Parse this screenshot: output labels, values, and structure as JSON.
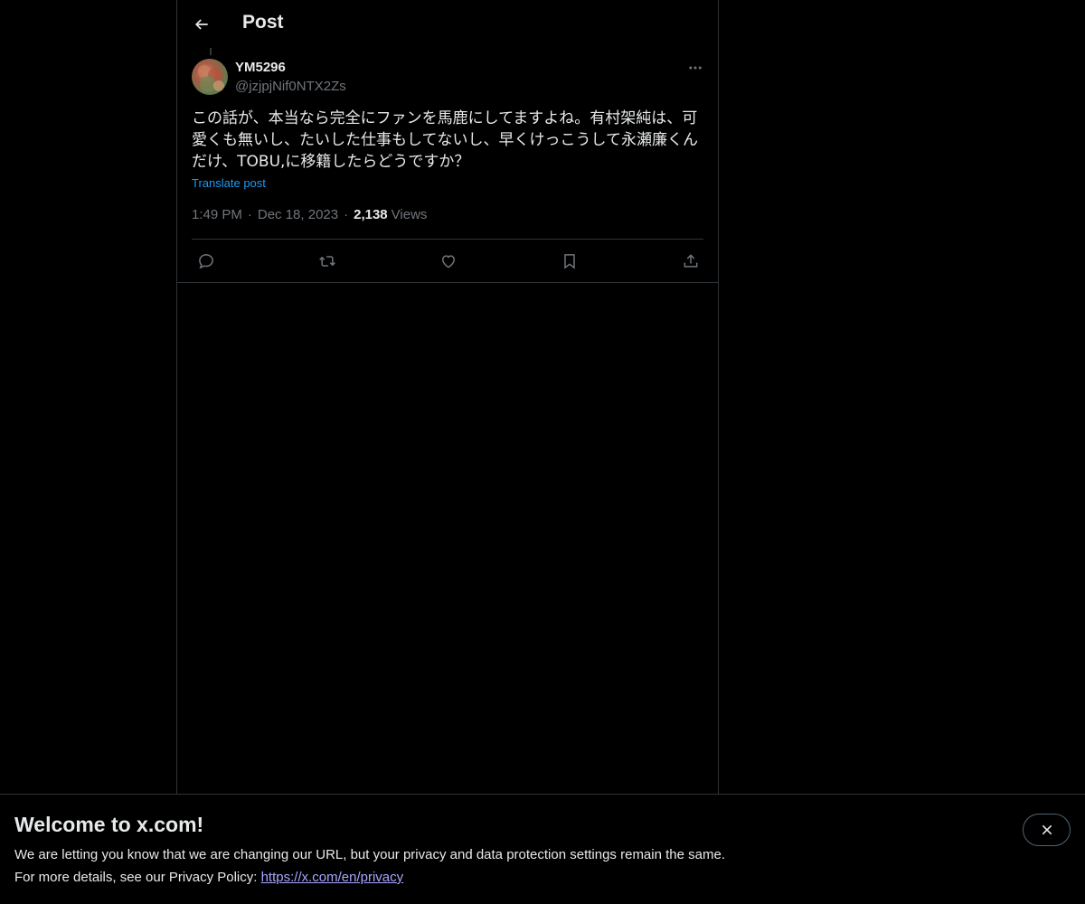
{
  "header": {
    "title": "Post"
  },
  "post": {
    "display_name": "YM5296",
    "handle": "@jzjpjNif0NTX2Zs",
    "text": "この話が、本当なら完全にファンを馬鹿にしてますよね。有村架純は、可愛くも無いし、たいした仕事もしてないし、早くけっこうして永瀬廉くんだけ、TOBU,に移籍したらどうですか？",
    "translate_label": "Translate post",
    "time": "1:49 PM",
    "separator": "·",
    "date": "Dec 18, 2023",
    "views_count": "2,138",
    "views_label": "Views"
  },
  "actions": [
    "reply-icon",
    "repost-icon",
    "like-icon",
    "bookmark-icon",
    "share-icon"
  ],
  "banner": {
    "title": "Welcome to x.com!",
    "line1": "We are letting you know that we are changing our URL, but your privacy and data protection settings remain the same.",
    "line2_prefix": "For more details, see our Privacy Policy: ",
    "link": "https://x.com/en/privacy"
  },
  "colors": {
    "background": "#000000",
    "text": "#e7e9ea",
    "muted": "#71767b",
    "accent": "#1d9bf0",
    "link": "#a9a6ff",
    "border": "#2f3336"
  }
}
